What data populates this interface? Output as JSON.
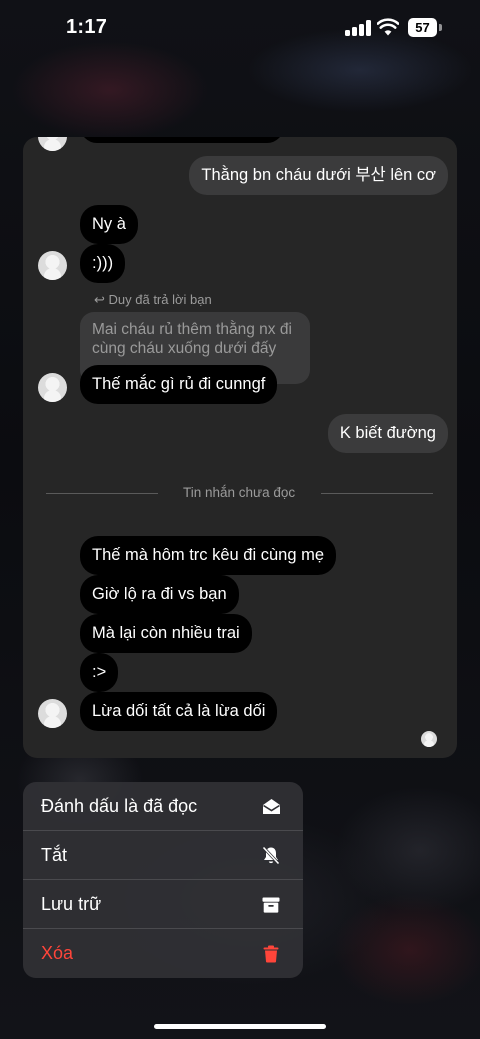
{
  "status_bar": {
    "time": "1:17",
    "battery": "57",
    "signal_icon": "cellular-signal-icon",
    "wifi_icon": "wifi-icon"
  },
  "chat": {
    "messages": [
      {
        "direction": "out",
        "text": "Thằng bn cháu dưới 부산 lên cơ"
      },
      {
        "direction": "in",
        "text": "Ny à"
      },
      {
        "direction": "in",
        "text": ":)))"
      },
      {
        "direction": "in",
        "text": "Thế mắc gì rủ đi cunngf"
      },
      {
        "direction": "out",
        "text": "K biết đường"
      },
      {
        "direction": "in",
        "text": "Thế mà hôm trc kêu đi cùng mẹ"
      },
      {
        "direction": "in",
        "text": "Giờ lộ ra đi vs bạn"
      },
      {
        "direction": "in",
        "text": "Mà lại còn nhiều trai"
      },
      {
        "direction": "in",
        "text": ":>"
      },
      {
        "direction": "in",
        "text": "Lừa dối tất cả là lừa dối"
      }
    ],
    "reply": {
      "label": "Duy đã trả lời bạn",
      "quoted_text": "Mai cháu rủ thêm thằng nx đi cùng cháu xuống dưới đấy"
    },
    "unread_divider": "Tin nhắn chưa đọc"
  },
  "menu": {
    "items": [
      {
        "label": "Đánh dấu là đã đọc",
        "icon": "mark-read-icon",
        "danger": false
      },
      {
        "label": "Tắt",
        "icon": "mute-bell-icon",
        "danger": false
      },
      {
        "label": "Lưu trữ",
        "icon": "archive-icon",
        "danger": false
      },
      {
        "label": "Xóa",
        "icon": "trash-icon",
        "danger": true
      }
    ],
    "danger_color": "#ff453a"
  }
}
